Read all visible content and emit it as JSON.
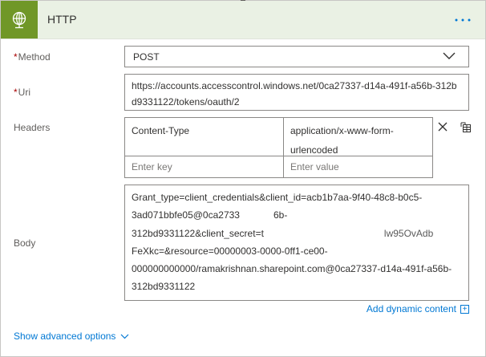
{
  "header": {
    "title": "HTTP",
    "icon": "globe-icon",
    "more_icon": "more-dots-icon",
    "accent_color": "#709727"
  },
  "method": {
    "label": "Method",
    "required": "*",
    "value": "POST"
  },
  "uri": {
    "label": "Uri",
    "required": "*",
    "value": "https://accounts.accesscontrol.windows.net/0ca27337-d14a-491f-a56b-312bd9331122/tokens/oauth/2"
  },
  "headers": {
    "label": "Headers",
    "rows": [
      {
        "key": "Content-Type",
        "value": "application/x-www-form-urlencoded"
      }
    ],
    "key_placeholder": "Enter key",
    "value_placeholder": "Enter value"
  },
  "body": {
    "label": "Body",
    "lines": [
      "Grant_type=client_credentials&client_id=acb1b7aa-9f40-48c8-b0c5-",
      "3ad071bbfe05@0ca2733",
      "6b-",
      "312bd9331122&client_secret=t",
      "lw95OvAdb",
      "FeXkc=&resource=00000003-0000-0ff1-ce00-",
      "000000000000/ramakrishnan.sharepoint.com@0ca27337-d14a-491f-a56b-",
      "312bd9331122"
    ]
  },
  "add_dynamic": {
    "label": "Add dynamic content",
    "icon": "plus-box-icon"
  },
  "advanced": {
    "label": "Show advanced options",
    "icon": "chevron-down-icon"
  },
  "colors": {
    "link": "#0078d4",
    "required": "#a80000",
    "header_bg": "#eaf1e4"
  }
}
